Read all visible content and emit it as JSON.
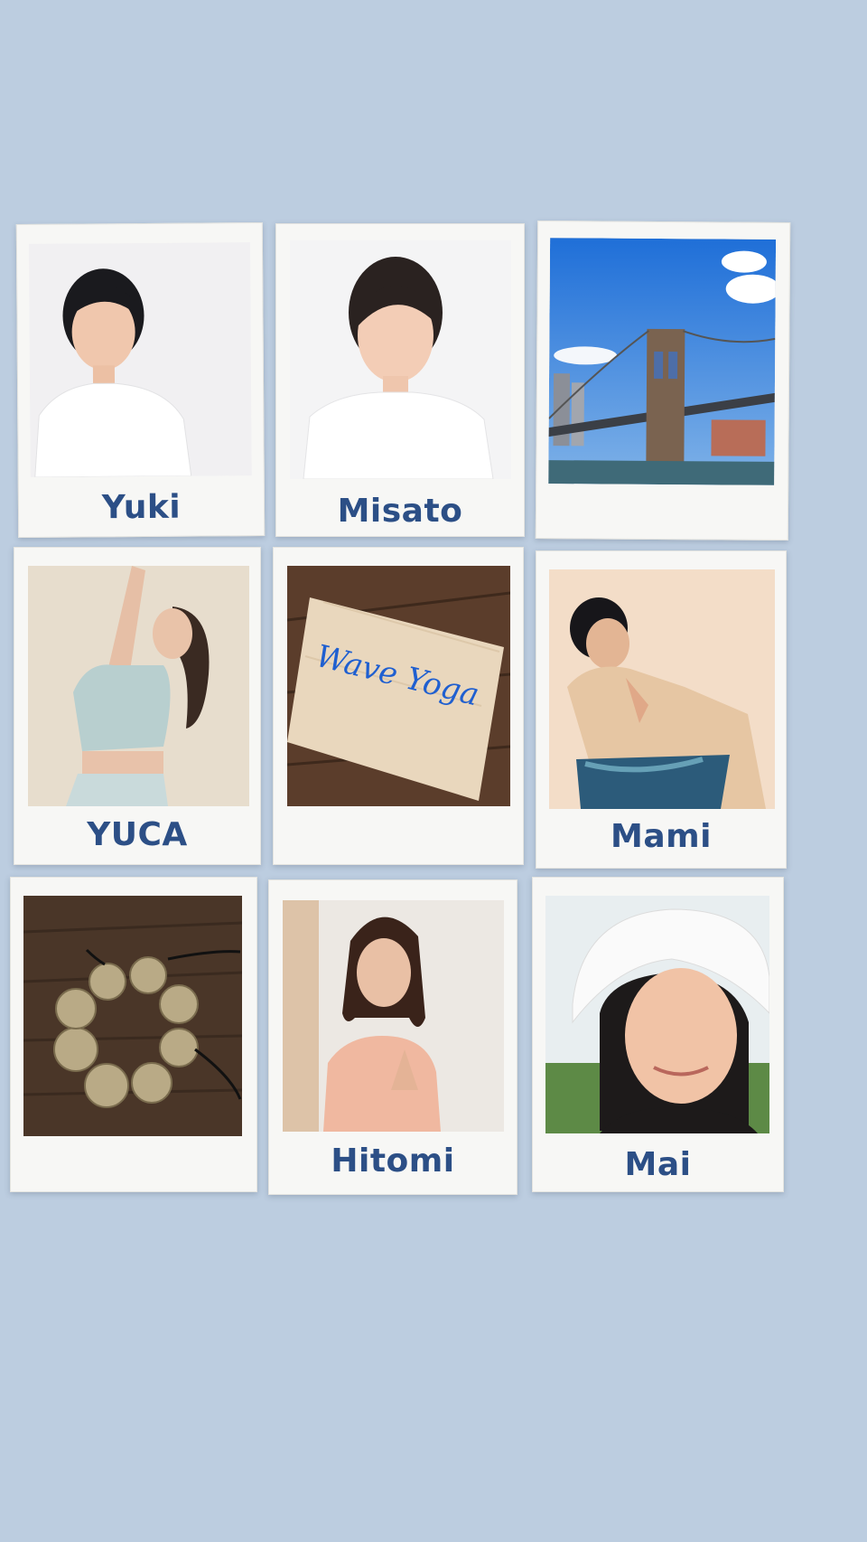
{
  "collage": {
    "cards": [
      {
        "name": "Yuki"
      },
      {
        "name": "Misato"
      },
      {
        "name": ""
      },
      {
        "name": "YUCA"
      },
      {
        "name": ""
      },
      {
        "name": "Mami"
      },
      {
        "name": ""
      },
      {
        "name": "Hitomi"
      },
      {
        "name": "Mai"
      }
    ],
    "sign_text": "Wave Yoga"
  },
  "colors": {
    "background": "#bccde0",
    "card": "#f7f7f5",
    "caption": "#2c4f86",
    "sign_script": "#1f5fd0"
  },
  "icons": {
    "bridge_photo": "bridge-photo-icon",
    "sign_photo": "wave-yoga-sign-icon",
    "cymbals_photo": "tingsha-cymbals-icon"
  }
}
